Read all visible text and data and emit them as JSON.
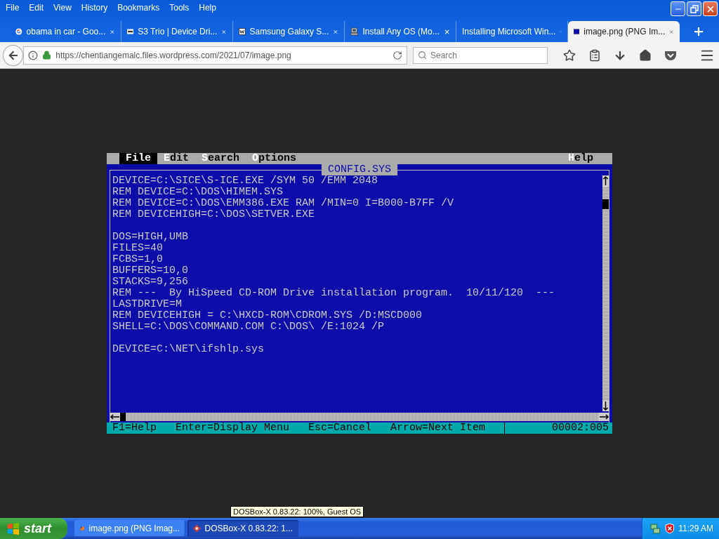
{
  "browser": {
    "menu": [
      "File",
      "Edit",
      "View",
      "History",
      "Bookmarks",
      "Tools",
      "Help"
    ],
    "tabs": [
      {
        "title": "obama in car - Goo...",
        "kind": "google",
        "selected": false
      },
      {
        "title": "S3 Trio | Device Dri...",
        "kind": "oem",
        "selected": false
      },
      {
        "title": "Samsung Galaxy S...",
        "kind": "wiki",
        "selected": false
      },
      {
        "title": "Install Any OS (Mo...",
        "kind": "computer",
        "selected": false
      },
      {
        "title": "Installing Microsoft Win...",
        "selected": false
      },
      {
        "title": "image.png (PNG Im...",
        "kind": "image",
        "selected": true
      }
    ],
    "address": "https://chentiangemalc.files.wordpress.com/2021/07/image.png",
    "search": {
      "placeholder": "Search"
    }
  },
  "dos_editor": {
    "menu": [
      {
        "label": "File",
        "selected": true
      },
      {
        "label": "Edit",
        "selected": false
      },
      {
        "label": "Search",
        "selected": false
      },
      {
        "label": "Options",
        "selected": false
      }
    ],
    "right_menu": [
      {
        "label": "Help",
        "selected": false
      }
    ],
    "title": "CONFIG.SYS",
    "paragraphs": [
      [
        "DEVICE=C:\\SICE\\S-ICE.EXE /SYM 50 /EMM 2048",
        "REM DEVICE=C:\\DOS\\HIMEM.SYS",
        "REM DEVICE=C:\\DOS\\EMM386.EXE RAM /MIN=0 I=B000-B7FF /V",
        "REM DEVICEHIGH=C:\\DOS\\SETVER.EXE"
      ],
      [
        "DOS=HIGH,UMB",
        "FILES=40",
        "FCBS=1,0",
        "BUFFERS=10,0",
        "STACKS=9,256",
        "REM ---  By HiSpeed CD-ROM Drive installation program.  10/11/120  ---",
        "LASTDRIVE=M",
        "REM DEVICEHIGH = C:\\HXCD-ROM\\CDROM.SYS /D:MSCD000",
        "SHELL=C:\\DOS\\COMMAND.COM C:\\DOS\\ /E:1024 /P"
      ],
      [
        "DEVICE=C:\\NET\\ifshlp.sys"
      ]
    ],
    "status": [
      "F1=Help",
      "Enter=Display Menu",
      "Esc=Cancel",
      "Arrow=Next Item"
    ],
    "position": "00002:005"
  },
  "tooltip": "DOSBox-X 0.83.22: 100%, Guest OS",
  "taskbar": {
    "start": "start",
    "tasks": [
      {
        "label": "image.png (PNG Imag...",
        "kind": "firefox",
        "selected": false
      },
      {
        "label": "DOSBox-X 0.83.22: 1...",
        "kind": "dosbox",
        "selected": true
      }
    ],
    "clock": "11:29 AM"
  }
}
